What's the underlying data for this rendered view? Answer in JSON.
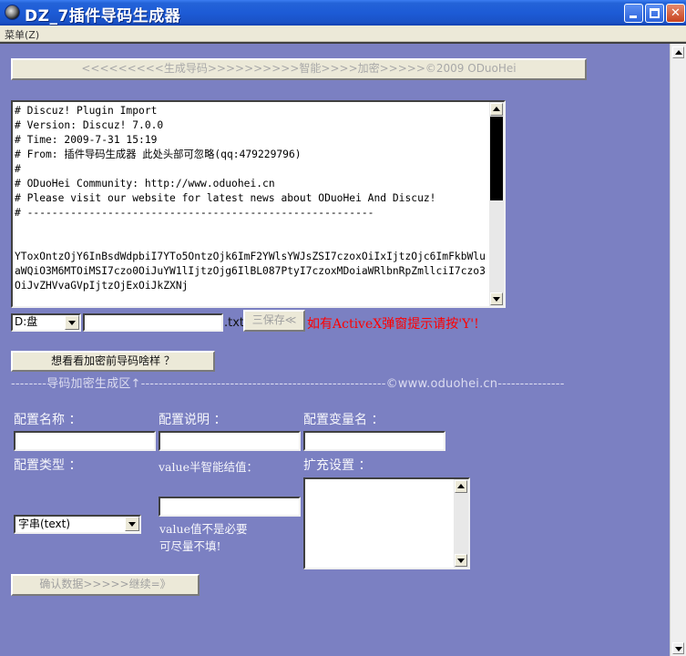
{
  "window": {
    "title": "DZ_7插件导码生成器",
    "minimize_label": "",
    "maximize_label": "",
    "close_label": "✕"
  },
  "menubar": {
    "menu_label": "菜单(Z)"
  },
  "banner": {
    "label": "<<<<<<<<<生成导码>>>>>>>>>>智能>>>>加密>>>>>©2009 ODuoHei"
  },
  "code": {
    "content": "# Discuz! Plugin Import\n# Version: Discuz! 7.0.0\n# Time: 2009-7-31 15:19\n# From: 插件导码生成器 此处头部可忽略(qq:479229796)\n#\n# ODuoHei Community: http://www.oduohei.cn\n# Please visit our website for latest news about ODuoHei And Discuz!\n# --------------------------------------------------------\n\n\nYToxOntzOjY6InBsdWdpbiI7YTo5OntzOjk6ImF2YWlsYWJsZSI7czoxOiIxIjtzOjc6ImFkbWluaWQiO3M6MTOiMSI7czo0OiJuYW1lIjtzOjg6IlBL087PtyI7czoxMDoiaWRlbnRpZmllciI7czo3OiJvZHVvaGVpIjtzOjExOiJkZXNj"
  },
  "save_row": {
    "drive": "D:盘",
    "filename": "",
    "ext": ".txt",
    "save_label": "三保存≪",
    "hint": "如有ActiveX弹窗提示请按'Y'!"
  },
  "preview_button": "想看看加密前导码啥样 ？",
  "divider": "--------导码加密生成区↑-------------------------------------------------------©www.oduohei.cn---------------",
  "form": {
    "config_name_label": "配置名称 ：",
    "config_desc_label": "配置说明 ：",
    "config_var_label": "配置变量名 ：",
    "config_type_label": "配置类型 ：",
    "value_label": "value半智能结值：",
    "ext_label": "扩充设置 ：",
    "type_value": "字串(text)",
    "value_note_1": "value值不是必要",
    "value_note_2": "可尽量不填!",
    "confirm_label": "确认数据>>>>>继续=》"
  }
}
